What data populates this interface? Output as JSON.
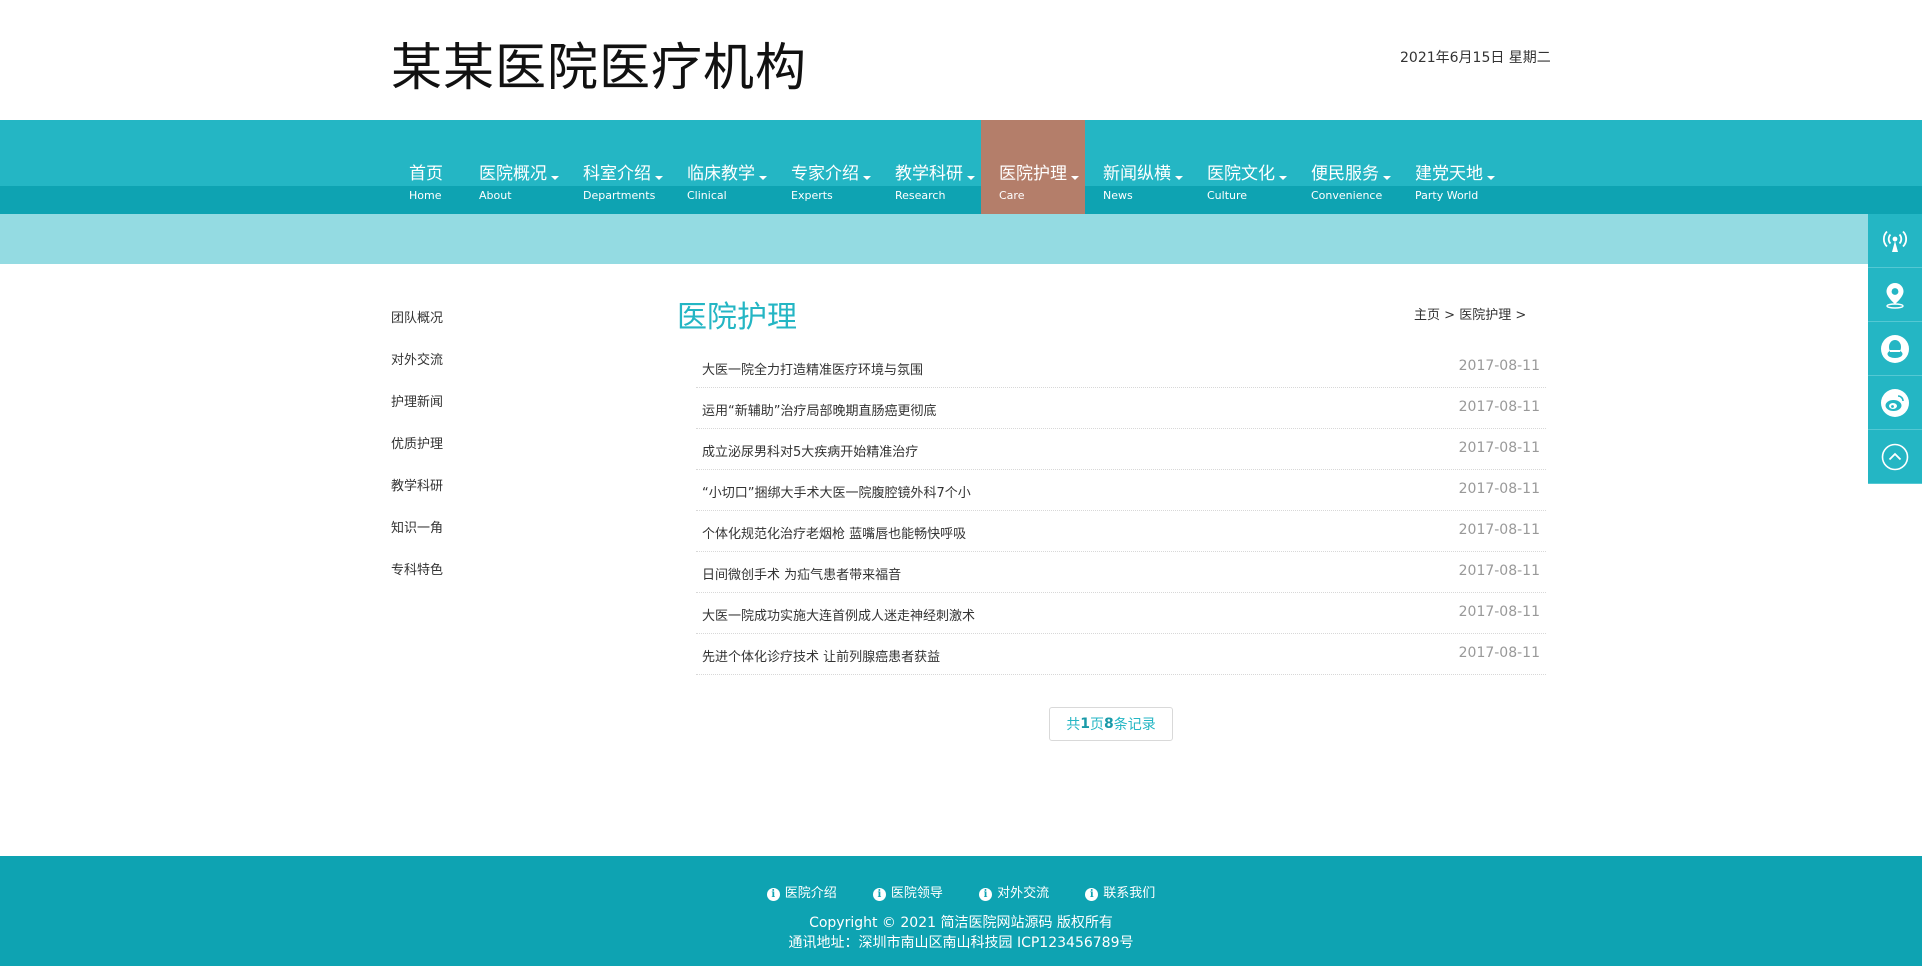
{
  "header": {
    "site_title": "某某医院医疗机构",
    "date": "2021年6月15日 星期二"
  },
  "nav": {
    "items": [
      {
        "cn": "首页",
        "en": "Home",
        "has_dropdown": false,
        "active": false
      },
      {
        "cn": "医院概况",
        "en": "About",
        "has_dropdown": true,
        "active": false
      },
      {
        "cn": "科室介绍",
        "en": "Departments",
        "has_dropdown": true,
        "active": false
      },
      {
        "cn": "临床教学",
        "en": "Clinical",
        "has_dropdown": true,
        "active": false
      },
      {
        "cn": "专家介绍",
        "en": "Experts",
        "has_dropdown": true,
        "active": false
      },
      {
        "cn": "教学科研",
        "en": "Research",
        "has_dropdown": true,
        "active": false
      },
      {
        "cn": "医院护理",
        "en": "Care",
        "has_dropdown": true,
        "active": true
      },
      {
        "cn": "新闻纵横",
        "en": "News",
        "has_dropdown": true,
        "active": false
      },
      {
        "cn": "医院文化",
        "en": "Culture",
        "has_dropdown": true,
        "active": false
      },
      {
        "cn": "便民服务",
        "en": "Convenience",
        "has_dropdown": true,
        "active": false
      },
      {
        "cn": "建党天地",
        "en": "Party World",
        "has_dropdown": true,
        "active": false
      }
    ]
  },
  "side_tools": {
    "icons": [
      "broadcast-icon",
      "location-pin-icon",
      "qq-icon",
      "weibo-icon",
      "back-to-top-icon"
    ]
  },
  "sidebar": {
    "items": [
      "团队概况",
      "对外交流",
      "护理新闻",
      "优质护理",
      "教学科研",
      "知识一角",
      "专科特色"
    ]
  },
  "main": {
    "title": "医院护理",
    "breadcrumb": {
      "home": "主页",
      "sep": ">",
      "current": "医院护理"
    },
    "news": [
      {
        "title": "大医一院全力打造精准医疗环境与氛围",
        "date": "2017-08-11"
      },
      {
        "title": "运用“新辅助”治疗局部晚期直肠癌更彻底",
        "date": "2017-08-11"
      },
      {
        "title": "成立泌尿男科对5大疾病开始精准治疗",
        "date": "2017-08-11"
      },
      {
        "title": "“小切口”捆绑大手术大医一院腹腔镜外科7个小",
        "date": "2017-08-11"
      },
      {
        "title": "个体化规范化治疗老烟枪 蓝嘴唇也能畅快呼吸",
        "date": "2017-08-11"
      },
      {
        "title": "日间微创手术 为疝气患者带来福音",
        "date": "2017-08-11"
      },
      {
        "title": "大医一院成功实施大连首例成人迷走神经刺激术",
        "date": "2017-08-11"
      },
      {
        "title": "先进个体化诊疗技术 让前列腺癌患者获益",
        "date": "2017-08-11"
      }
    ],
    "pager": {
      "prefix": "共 ",
      "pages": "1",
      "mid": "页",
      "records": "8",
      "suffix": "条记录"
    }
  },
  "footer": {
    "links": [
      "医院介绍",
      "医院领导",
      "对外交流",
      "联系我们"
    ],
    "copyright": "Copyright © 2021 简洁医院网站源码 版权所有",
    "address": "通讯地址：深圳市南山区南山科技园 ICP123456789号"
  },
  "colors": {
    "primary": "#24b6c4",
    "primary_dark": "#0ea3b2",
    "banner": "#94dbe2",
    "active_nav": "#b47e6a",
    "date_gray": "#999999"
  }
}
